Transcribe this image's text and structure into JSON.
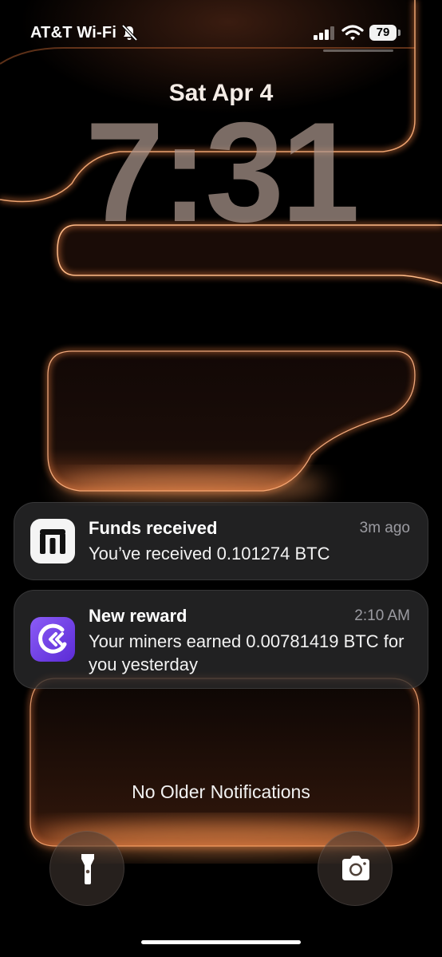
{
  "status_bar": {
    "carrier": "AT&T Wi-Fi",
    "battery": "79",
    "icons": [
      "bell-slash-icon",
      "cellular-signal-icon",
      "wifi-icon",
      "battery-icon"
    ]
  },
  "lock_screen": {
    "date": "Sat Apr 4",
    "time": "7:31"
  },
  "notifications": [
    {
      "app_icon": "exchange-app-icon",
      "title": "Funds received",
      "time": "3m ago",
      "body": "You’ve received 0.101274 BTC"
    },
    {
      "app_icon": "mining-app-icon",
      "title": "New reward",
      "time": "2:10 AM",
      "body": "Your miners earned 0.00781419 BTC for you yesterday"
    }
  ],
  "footer": {
    "no_older": "No Older Notifications"
  },
  "quick_actions": {
    "left_icon": "flashlight-icon",
    "right_icon": "camera-icon"
  },
  "colors": {
    "wallpaper_glow": "#e0763a",
    "app_purple": "#7c4dff"
  }
}
